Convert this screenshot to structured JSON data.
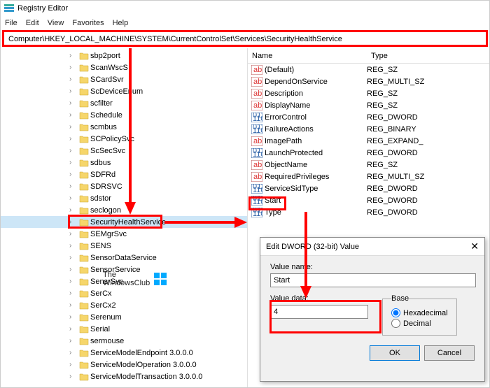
{
  "window": {
    "title": "Registry Editor"
  },
  "menu": {
    "file": "File",
    "edit": "Edit",
    "view": "View",
    "favorites": "Favorites",
    "help": "Help"
  },
  "address": {
    "path": "Computer\\HKEY_LOCAL_MACHINE\\SYSTEM\\CurrentControlSet\\Services\\SecurityHealthService"
  },
  "tree": [
    "sbp2port",
    "ScanWscS",
    "SCardSvr",
    "ScDeviceEnum",
    "scfilter",
    "Schedule",
    "scmbus",
    "SCPolicySvc",
    "ScSecSvc",
    "sdbus",
    "SDFRd",
    "SDRSVC",
    "sdstor",
    "seclogon",
    "SecurityHealthService",
    "SEMgrSvc",
    "SENS",
    "SensorDataService",
    "SensorService",
    "SensrSvc",
    "SerCx",
    "SerCx2",
    "Serenum",
    "Serial",
    "sermouse",
    "ServiceModelEndpoint 3.0.0.0",
    "ServiceModelOperation 3.0.0.0",
    "ServiceModelTransaction 3.0.0.0"
  ],
  "tree_selected_index": 14,
  "list": {
    "header_name": "Name",
    "header_type": "Type"
  },
  "values": [
    {
      "name": "(Default)",
      "type": "REG_SZ",
      "icon": "ab"
    },
    {
      "name": "DependOnService",
      "type": "REG_MULTI_SZ",
      "icon": "ab"
    },
    {
      "name": "Description",
      "type": "REG_SZ",
      "icon": "ab"
    },
    {
      "name": "DisplayName",
      "type": "REG_SZ",
      "icon": "ab"
    },
    {
      "name": "ErrorControl",
      "type": "REG_DWORD",
      "icon": "bin"
    },
    {
      "name": "FailureActions",
      "type": "REG_BINARY",
      "icon": "bin"
    },
    {
      "name": "ImagePath",
      "type": "REG_EXPAND_",
      "icon": "ab"
    },
    {
      "name": "LaunchProtected",
      "type": "REG_DWORD",
      "icon": "bin"
    },
    {
      "name": "ObjectName",
      "type": "REG_SZ",
      "icon": "ab"
    },
    {
      "name": "RequiredPrivileges",
      "type": "REG_MULTI_SZ",
      "icon": "ab"
    },
    {
      "name": "ServiceSidType",
      "type": "REG_DWORD",
      "icon": "bin"
    },
    {
      "name": "Start",
      "type": "REG_DWORD",
      "icon": "bin"
    },
    {
      "name": "Type",
      "type": "REG_DWORD",
      "icon": "bin"
    }
  ],
  "dialog": {
    "title": "Edit DWORD (32-bit) Value",
    "name_label": "Value name:",
    "name_value": "Start",
    "data_label": "Value data:",
    "data_value": "4",
    "base_label": "Base",
    "hex_label": "Hexadecimal",
    "dec_label": "Decimal",
    "ok": "OK",
    "cancel": "Cancel"
  },
  "watermark": {
    "line1": "The",
    "line2": "WindowsClub"
  }
}
